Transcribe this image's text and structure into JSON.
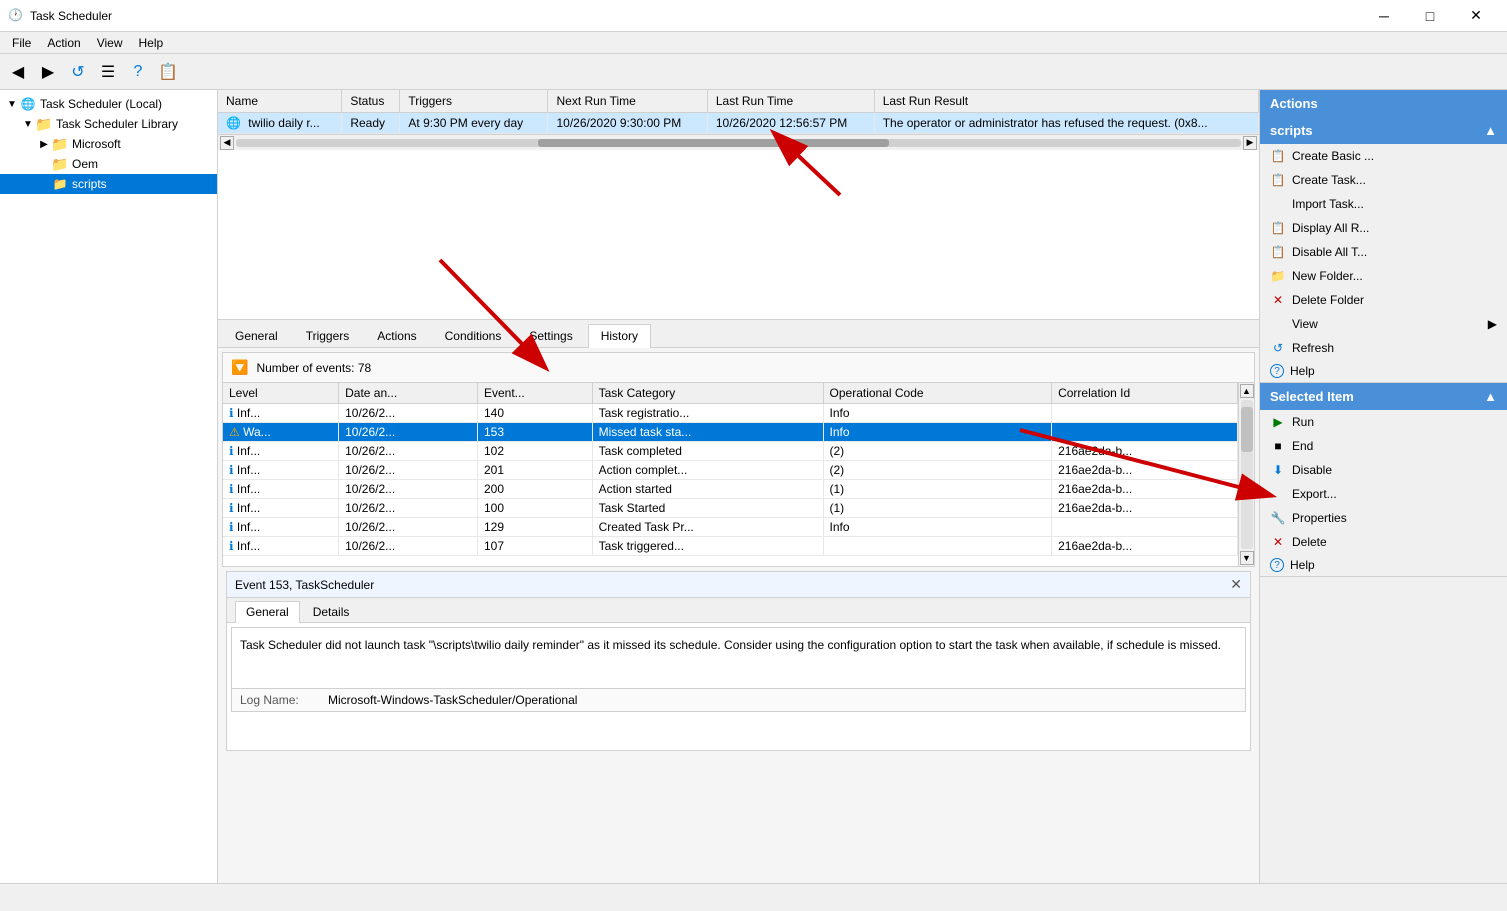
{
  "titleBar": {
    "title": "Task Scheduler",
    "controls": {
      "minimize": "─",
      "restore": "□",
      "close": "✕"
    }
  },
  "menuBar": {
    "items": [
      "File",
      "Action",
      "View",
      "Help"
    ]
  },
  "toolbar": {
    "buttons": [
      "◀",
      "▶",
      "↺",
      "☰",
      "?",
      "📋"
    ]
  },
  "sidebar": {
    "items": [
      {
        "id": "task-scheduler-local",
        "label": "Task Scheduler (Local)",
        "indent": 0,
        "icon": "globe",
        "expanded": true
      },
      {
        "id": "task-scheduler-library",
        "label": "Task Scheduler Library",
        "indent": 1,
        "icon": "folder",
        "expanded": true
      },
      {
        "id": "microsoft",
        "label": "Microsoft",
        "indent": 2,
        "icon": "folder",
        "expanded": false
      },
      {
        "id": "oem",
        "label": "Oem",
        "indent": 2,
        "icon": "folder",
        "expanded": false
      },
      {
        "id": "scripts",
        "label": "scripts",
        "indent": 2,
        "icon": "folder",
        "expanded": false,
        "selected": true
      }
    ]
  },
  "taskTable": {
    "columns": [
      "Name",
      "Status",
      "Triggers",
      "Next Run Time",
      "Last Run Time",
      "Last Run Result"
    ],
    "rows": [
      {
        "name": "twilio daily r...",
        "status": "Ready",
        "triggers": "At 9:30 PM every day",
        "nextRunTime": "10/26/2020 9:30:00 PM",
        "lastRunTime": "10/26/2020 12:56:57 PM",
        "lastRunResult": "The operator or administrator has refused the request. (0x8..."
      }
    ]
  },
  "tabs": {
    "items": [
      "General",
      "Triggers",
      "Actions",
      "Conditions",
      "Settings",
      "History"
    ],
    "active": "History"
  },
  "historyPanel": {
    "eventCount": "Number of events: 78",
    "columns": [
      "Level",
      "Date an...",
      "Event...",
      "Task Category",
      "Operational Code",
      "Correlation Id"
    ],
    "rows": [
      {
        "level": "ℹ Inf...",
        "date": "10/26/2...",
        "event": "140",
        "category": "Task registratio...",
        "opCode": "Info",
        "corrId": "",
        "selected": false,
        "warn": false
      },
      {
        "level": "⚠ Wa...",
        "date": "10/26/2...",
        "event": "153",
        "category": "Missed task sta...",
        "opCode": "Info",
        "corrId": "",
        "selected": true,
        "warn": true
      },
      {
        "level": "ℹ Inf...",
        "date": "10/26/2...",
        "event": "102",
        "category": "Task completed",
        "opCode": "(2)",
        "corrId": "216ae2da-b...",
        "selected": false,
        "warn": false
      },
      {
        "level": "ℹ Inf...",
        "date": "10/26/2...",
        "event": "201",
        "category": "Action complet...",
        "opCode": "(2)",
        "corrId": "216ae2da-b...",
        "selected": false,
        "warn": false
      },
      {
        "level": "ℹ Inf...",
        "date": "10/26/2...",
        "event": "200",
        "category": "Action started",
        "opCode": "(1)",
        "corrId": "216ae2da-b...",
        "selected": false,
        "warn": false
      },
      {
        "level": "ℹ Inf...",
        "date": "10/26/2...",
        "event": "100",
        "category": "Task Started",
        "opCode": "(1)",
        "corrId": "216ae2da-b...",
        "selected": false,
        "warn": false
      },
      {
        "level": "ℹ Inf...",
        "date": "10/26/2...",
        "event": "129",
        "category": "Created Task Pr...",
        "opCode": "Info",
        "corrId": "",
        "selected": false,
        "warn": false
      },
      {
        "level": "ℹ Inf...",
        "date": "10/26/2...",
        "event": "107",
        "category": "Task triggered...",
        "opCode": "",
        "corrId": "216ae2da-b...",
        "selected": false,
        "warn": false
      }
    ]
  },
  "eventPanel": {
    "title": "Event 153, TaskScheduler",
    "tabs": [
      "General",
      "Details"
    ],
    "activeTab": "General",
    "message": "Task Scheduler did not launch task \"\\scripts\\twilio daily reminder\" as it missed its schedule. Consider using the configuration option to start the task when available, if schedule is missed.",
    "logName": "Microsoft-Windows-TaskScheduler/Operational"
  },
  "actionsPanel": {
    "title": "Actions",
    "sections": [
      {
        "id": "scripts-section",
        "header": "scripts",
        "items": [
          {
            "id": "create-basic",
            "label": "Create Basic ...",
            "icon": "📋",
            "iconType": "blue"
          },
          {
            "id": "create-task",
            "label": "Create Task...",
            "icon": "📋",
            "iconType": "blue"
          },
          {
            "id": "import-task",
            "label": "Import Task...",
            "icon": "",
            "iconType": ""
          },
          {
            "id": "display-all-r",
            "label": "Display All R...",
            "icon": "📋",
            "iconType": "blue"
          },
          {
            "id": "disable-all-t",
            "label": "Disable All T...",
            "icon": "📋",
            "iconType": "blue"
          },
          {
            "id": "new-folder",
            "label": "New Folder...",
            "icon": "📁",
            "iconType": "yellow"
          },
          {
            "id": "delete-folder",
            "label": "Delete Folder",
            "icon": "✕",
            "iconType": "red"
          },
          {
            "id": "view",
            "label": "View",
            "icon": "",
            "iconType": ""
          },
          {
            "id": "refresh",
            "label": "Refresh",
            "icon": "↺",
            "iconType": "blue"
          },
          {
            "id": "help-scripts",
            "label": "Help",
            "icon": "?",
            "iconType": "blue"
          }
        ]
      },
      {
        "id": "selected-item-section",
        "header": "Selected Item",
        "items": [
          {
            "id": "run",
            "label": "Run",
            "icon": "▶",
            "iconType": "green"
          },
          {
            "id": "end",
            "label": "End",
            "icon": "■",
            "iconType": ""
          },
          {
            "id": "disable",
            "label": "Disable",
            "icon": "⬇",
            "iconType": "blue"
          },
          {
            "id": "export",
            "label": "Export...",
            "icon": "",
            "iconType": ""
          },
          {
            "id": "properties",
            "label": "Properties",
            "icon": "🔧",
            "iconType": "blue"
          },
          {
            "id": "delete",
            "label": "Delete",
            "icon": "✕",
            "iconType": "red"
          },
          {
            "id": "help-item",
            "label": "Help",
            "icon": "?",
            "iconType": "blue"
          }
        ]
      }
    ]
  }
}
